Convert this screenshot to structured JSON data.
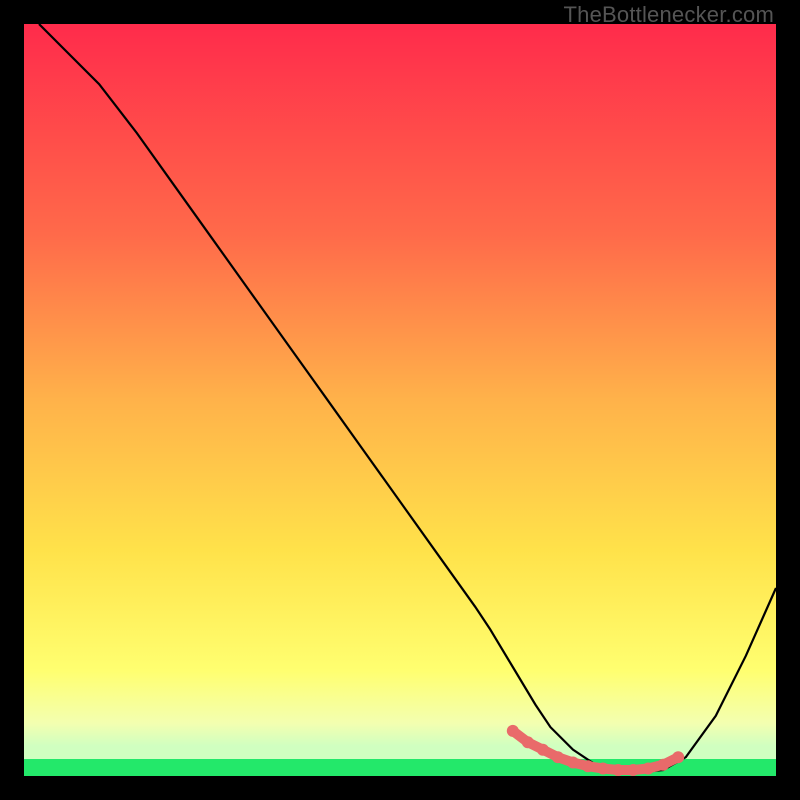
{
  "watermark": "TheBottlenecker.com",
  "chart_data": {
    "type": "line",
    "title": "",
    "xlabel": "",
    "ylabel": "",
    "xlim": [
      0,
      100
    ],
    "ylim": [
      0,
      100
    ],
    "background_gradient": {
      "top": "#ff2b4b",
      "mid1": "#ff944a",
      "mid2": "#ffe24a",
      "mid3": "#ffff80",
      "bottom_band": "#2dff6d"
    },
    "series": [
      {
        "name": "bottleneck-curve",
        "color": "#000000",
        "x": [
          2,
          6,
          10,
          15,
          20,
          25,
          30,
          35,
          40,
          45,
          50,
          55,
          60,
          62,
          65,
          68,
          70,
          73,
          76,
          78,
          80,
          82,
          85,
          88,
          92,
          96,
          100
        ],
        "y": [
          100,
          96,
          92,
          85.5,
          78.5,
          71.5,
          64.5,
          57.5,
          50.5,
          43.5,
          36.5,
          29.5,
          22.5,
          19.5,
          14.5,
          9.5,
          6.5,
          3.5,
          1.5,
          0.8,
          0.5,
          0.5,
          0.8,
          2.5,
          8.0,
          16.0,
          25.0
        ]
      },
      {
        "name": "optimal-band",
        "color": "#e96a6a",
        "style": "dotted-blob",
        "x": [
          65,
          67,
          69,
          71,
          73,
          75,
          77,
          79,
          81,
          83,
          85,
          87
        ],
        "y": [
          6,
          4.5,
          3.5,
          2.5,
          1.8,
          1.3,
          1.0,
          0.8,
          0.8,
          1.0,
          1.5,
          2.5
        ]
      }
    ]
  }
}
